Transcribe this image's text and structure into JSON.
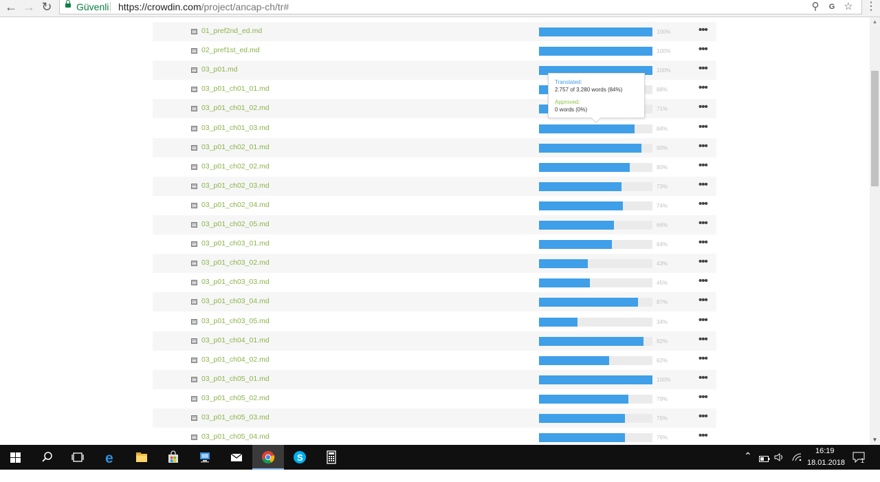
{
  "browser": {
    "secure_label": "Güvenli",
    "url_main": "https://crowdin.com",
    "url_rest": "/project/ancap-ch/tr#"
  },
  "files": [
    {
      "name": "01_pref2nd_ed.md",
      "percent": 100,
      "percent_label": "100%"
    },
    {
      "name": "02_pref1st_ed.md",
      "percent": 100,
      "percent_label": "100%"
    },
    {
      "name": "03_p01.md",
      "percent": 100,
      "percent_label": "100%"
    },
    {
      "name": "03_p01_ch01_01.md",
      "percent": 88,
      "percent_label": "88%"
    },
    {
      "name": "03_p01_ch01_02.md",
      "percent": 71,
      "percent_label": "71%"
    },
    {
      "name": "03_p01_ch01_03.md",
      "percent": 84,
      "percent_label": "84%"
    },
    {
      "name": "03_p01_ch02_01.md",
      "percent": 90,
      "percent_label": "90%"
    },
    {
      "name": "03_p01_ch02_02.md",
      "percent": 80,
      "percent_label": "80%"
    },
    {
      "name": "03_p01_ch02_03.md",
      "percent": 73,
      "percent_label": "73%"
    },
    {
      "name": "03_p01_ch02_04.md",
      "percent": 74,
      "percent_label": "74%"
    },
    {
      "name": "03_p01_ch02_05.md",
      "percent": 66,
      "percent_label": "66%"
    },
    {
      "name": "03_p01_ch03_01.md",
      "percent": 64,
      "percent_label": "64%"
    },
    {
      "name": "03_p01_ch03_02.md",
      "percent": 43,
      "percent_label": "43%"
    },
    {
      "name": "03_p01_ch03_03.md",
      "percent": 45,
      "percent_label": "45%"
    },
    {
      "name": "03_p01_ch03_04.md",
      "percent": 87,
      "percent_label": "87%"
    },
    {
      "name": "03_p01_ch03_05.md",
      "percent": 34,
      "percent_label": "34%"
    },
    {
      "name": "03_p01_ch04_01.md",
      "percent": 92,
      "percent_label": "92%"
    },
    {
      "name": "03_p01_ch04_02.md",
      "percent": 62,
      "percent_label": "62%"
    },
    {
      "name": "03_p01_ch05_01.md",
      "percent": 100,
      "percent_label": "100%"
    },
    {
      "name": "03_p01_ch05_02.md",
      "percent": 79,
      "percent_label": "79%"
    },
    {
      "name": "03_p01_ch05_03.md",
      "percent": 76,
      "percent_label": "76%"
    },
    {
      "name": "03_p01_ch05_04.md",
      "percent": 76,
      "percent_label": "76%"
    }
  ],
  "more_label": "•••",
  "tooltip": {
    "translated_label": "Translated:",
    "translated_value": "2.757 of 3.280 words (84%)",
    "approved_label": "Approved:",
    "approved_value": "0 words (0%)"
  },
  "taskbar": {
    "time": "16:19",
    "date": "18.01.2018",
    "notification_count": "1"
  },
  "colors": {
    "progress": "#3f9fe8",
    "filename": "#8bb34b",
    "approved": "#8bc34a"
  }
}
